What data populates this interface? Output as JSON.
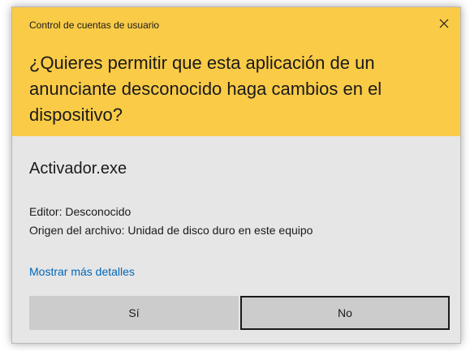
{
  "dialog": {
    "title": "Control de cuentas de usuario",
    "question": "¿Quieres permitir que esta aplicación de un anunciante desconocido haga cambios en el dispositivo?",
    "app_name": "Activador.exe",
    "publisher": "Editor: Desconocido",
    "origin": "Origen del archivo: Unidad de disco duro en este equipo",
    "details_link": "Mostrar más detalles",
    "yes_label": "Sí",
    "no_label": "No"
  },
  "colors": {
    "header_bg": "#f9cb47",
    "body_bg": "#e6e6e6",
    "link": "#0067b8",
    "button_bg": "#cccccc"
  },
  "icons": {
    "close": "close-icon"
  }
}
